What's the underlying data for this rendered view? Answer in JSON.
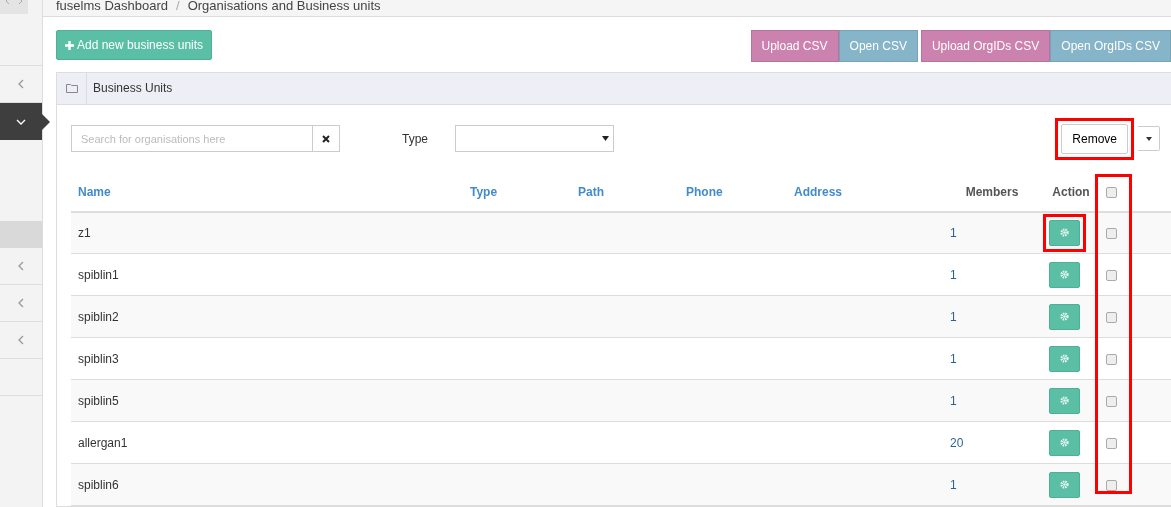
{
  "breadcrumb": [
    "fuselms Dashboard",
    "Organisations and Business units"
  ],
  "breadcrumb_separator": "/",
  "sidebar": {
    "items": [
      {
        "kind": "menu",
        "expanded": false,
        "selected": false
      },
      {
        "kind": "menu",
        "expanded": true,
        "selected": true,
        "children": [
          {
            "selected": true
          }
        ]
      },
      {
        "kind": "menu",
        "expanded": false,
        "selected": false
      },
      {
        "kind": "menu",
        "expanded": false,
        "selected": false
      },
      {
        "kind": "menu",
        "expanded": false,
        "selected": false
      }
    ]
  },
  "add_button": "Add new business units",
  "csv_buttons": [
    {
      "label": "Upload CSV",
      "kind": "upload"
    },
    {
      "label": "Open CSV",
      "kind": "open"
    },
    {
      "label": "Upload OrgIDs CSV",
      "kind": "upload"
    },
    {
      "label": "Open OrgIDs CSV",
      "kind": "open"
    }
  ],
  "panel": {
    "title": "Business Units"
  },
  "search": {
    "placeholder": "Search for organisations here"
  },
  "type_filter": {
    "label": "Type"
  },
  "remove_button": {
    "label": "Remove",
    "highlighted": true
  },
  "table": {
    "columns": [
      {
        "label": "Name",
        "link": true
      },
      {
        "label": "Type",
        "link": true
      },
      {
        "label": "Path",
        "link": true
      },
      {
        "label": "Phone",
        "link": true
      },
      {
        "label": "Address",
        "link": true
      },
      {
        "label": "Members",
        "link": false
      },
      {
        "label": "Action",
        "link": false
      }
    ],
    "select_all_checked": false,
    "checkbox_column_highlighted": true,
    "rows": [
      {
        "name": "z1",
        "members": "1",
        "checked": false,
        "action_highlighted": true
      },
      {
        "name": "spiblin1",
        "members": "1",
        "checked": false,
        "action_highlighted": false
      },
      {
        "name": "spiblin2",
        "members": "1",
        "checked": false,
        "action_highlighted": false
      },
      {
        "name": "spiblin3",
        "members": "1",
        "checked": false,
        "action_highlighted": false
      },
      {
        "name": "spiblin5",
        "members": "1",
        "checked": false,
        "action_highlighted": false
      },
      {
        "name": "allergan1",
        "members": "20",
        "checked": false,
        "action_highlighted": false
      },
      {
        "name": "spiblin6",
        "members": "1",
        "checked": false,
        "action_highlighted": false
      }
    ]
  }
}
